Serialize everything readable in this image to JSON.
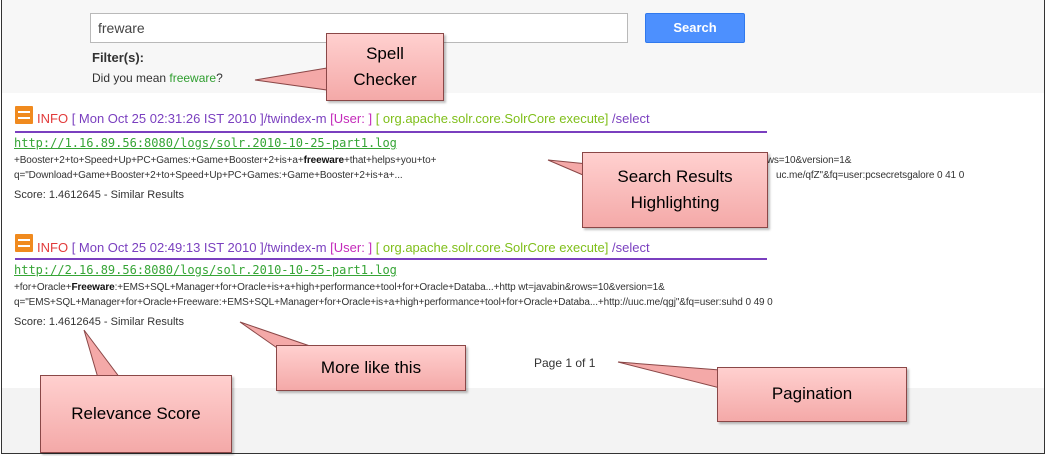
{
  "search": {
    "value": "freware",
    "button_label": "Search"
  },
  "filters": {
    "label": "Filter(s):"
  },
  "spellcheck": {
    "prefix": "Did you mean ",
    "suggestion": "freeware",
    "suffix": "?"
  },
  "results": [
    {
      "info": {
        "level": "INFO",
        "timestamp": "[ Mon Oct 25 02:31:26 IST 2010 ]",
        "core": "/twindex-m",
        "user": "[User: ]",
        "class": "[ org.apache.solr.core.SolrCore execute]",
        "path": "/select"
      },
      "url": "http://1.16.89.56:8080/logs/solr.2010-10-25-part1.log",
      "snippet_line1": {
        "pre": "+Booster+2+to+Speed+Up+PC+Games:+Game+Booster+2+is+a+",
        "hl": "freeware",
        "post": "+that+helps+you+to+",
        "tail": "abin&rows=10&version=1&"
      },
      "snippet_line2": {
        "pre": "q=\"Download+Game+Booster+2+to+Speed+Up+PC+Games:+Game+Booster+2+is+a+...",
        "tail": "uc.me/qfZ\"&fq=user:pcsecretsgalore 0 41 0"
      },
      "score": "Score: 1.4612645",
      "separator": " - ",
      "similar": "Similar Results"
    },
    {
      "info": {
        "level": "INFO",
        "timestamp": "[ Mon Oct 25 02:49:13 IST 2010 ]",
        "core": "/twindex-m",
        "user": "[User: ]",
        "class": "[ org.apache.solr.core.SolrCore execute]",
        "path": "/select"
      },
      "url": "http://2.16.89.56:8080/logs/solr.2010-10-25-part1.log",
      "snippet_line1": {
        "pre": "+for+Oracle+",
        "hl": "Freeware",
        "post": ":+EMS+SQL+Manager+for+Oracle+is+a+high+performance+tool+for+Oracle+Databa...+http wt=javabin&rows=10&version=1&"
      },
      "snippet_line2": {
        "pre": "q=\"EMS+SQL+Manager+for+Oracle+Freeware:+EMS+SQL+Manager+for+Oracle+is+a+high+performance+tool+for+Oracle+Databa...+http://uuc.me/qgj\"&fq=user:suhd 0 49 0"
      },
      "score": "Score: 1.4612645",
      "separator": " - ",
      "similar": "Similar Results"
    }
  ],
  "pagination": {
    "text": "Page 1 of 1"
  },
  "callouts": {
    "spell_checker": {
      "line1": "Spell",
      "line2": "Checker"
    },
    "highlighting": {
      "line1": "Search Results",
      "line2": "Highlighting"
    },
    "more_like_this": "More like this",
    "pagination": "Pagination",
    "relevance_score": "Relevance Score"
  },
  "colors": {
    "search_button": "#4d90fe",
    "info_level": "#e23b3b",
    "timestamp": "#7a3fbf",
    "user": "#c42aba",
    "class": "#7fbf1a",
    "url": "#36a536",
    "callout_fill": "#f4a9a8",
    "log_icon": "#f08a1e"
  }
}
